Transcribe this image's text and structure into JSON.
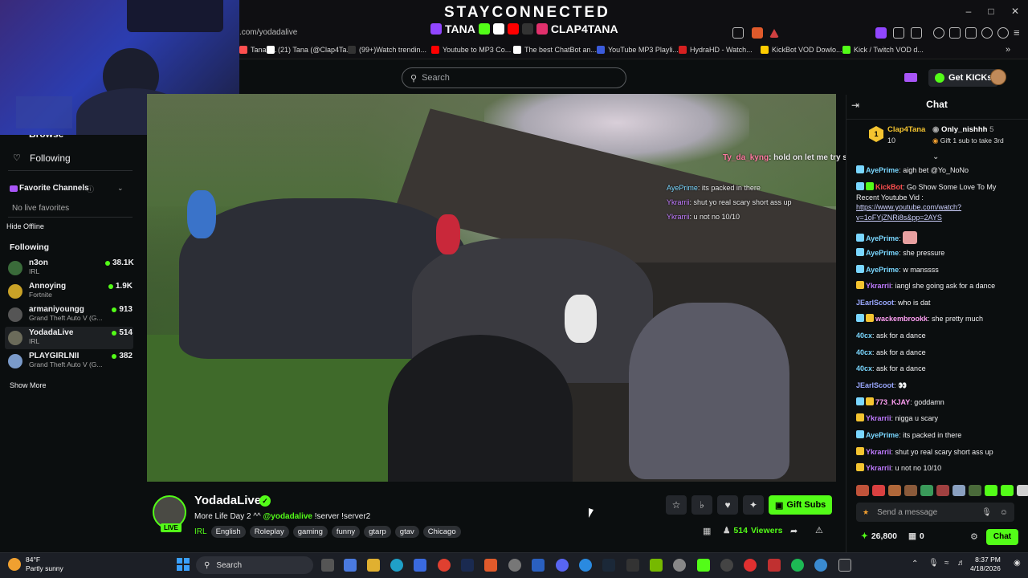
{
  "browser": {
    "url": ".com/yodadalive",
    "bookmarks": [
      {
        "label": "Tana -...",
        "color": "#ff4f4f"
      },
      {
        "label": "(21) Tana (@Clap4Ta...",
        "color": "#ffffff"
      },
      {
        "label": "(99+)Watch trendin...",
        "color": "#222222"
      },
      {
        "label": "Youtube to MP3 Co...",
        "color": "#ff0000"
      },
      {
        "label": "The best ChatBot an...",
        "color": "#ffffff"
      },
      {
        "label": "YouTube MP3 Playli...",
        "color": "#3b5bdb"
      },
      {
        "label": "HydraHD - Watch...",
        "color": "#d62020"
      },
      {
        "label": "KickBot VOD Dowlo...",
        "color": "#ffcc00"
      },
      {
        "label": "Kick / Twitch VOD d...",
        "color": "#53fc18"
      }
    ]
  },
  "overlay": {
    "headline": "STAYCONNECTED",
    "handle_left": "TANA",
    "handle_right": "CLAP4TANA"
  },
  "header": {
    "search_placeholder": "Search",
    "get_kicks": "Get KICKs"
  },
  "sidebar": {
    "browse_label": "Browse",
    "following_nav": "Following",
    "favorite_channels": "Favorite Channels",
    "no_favorites": "No live favorites",
    "hide_offline": "Hide Offline",
    "following_heading": "Following",
    "show_more": "Show More",
    "channels": [
      {
        "name": "n3on",
        "game": "IRL",
        "viewers": "38.1K",
        "avatar_color": "#3a6b3a"
      },
      {
        "name": "Annoying",
        "game": "Fortnite",
        "viewers": "1.9K",
        "avatar_color": "#c9a227"
      },
      {
        "name": "armaniyoungg",
        "game": "Grand Theft Auto V (G...",
        "viewers": "913",
        "avatar_color": "#555555"
      },
      {
        "name": "YodadaLive",
        "game": "IRL",
        "viewers": "514",
        "avatar_color": "#6b6b5a"
      },
      {
        "name": "PLAYGIRLNII",
        "game": "Grand Theft Auto V (G...",
        "viewers": "382",
        "avatar_color": "#7a9ac9"
      }
    ]
  },
  "video_overlay_chat": [
    {
      "user": "Ty_da_kyng",
      "text": ": hold on let me try sum"
    },
    {
      "user": "AyePrime",
      "text": ": its packed in there"
    },
    {
      "user": "Ykrarrii",
      "text": ": shut yo real scary short ass up"
    },
    {
      "user": "Ykrarrii",
      "text": ": u not no 10/10"
    }
  ],
  "stream": {
    "channel_name": "YodadaLive",
    "live_badge": "LIVE",
    "title_prefix": "More Life Day 2 ^^ ",
    "title_mention": "@yodadalive",
    "title_suffix": " !server !server2",
    "category": "IRL",
    "tags": [
      "English",
      "Roleplay",
      "gaming",
      "funny",
      "gtarp",
      "gtav",
      "Chicago"
    ],
    "gift_subs": "Gift Subs",
    "viewers": "514",
    "viewers_label": "Viewers"
  },
  "chat": {
    "title": "Chat",
    "pinned_gifter": "Clap4Tana",
    "pinned_gifter_count": "10",
    "pinned_top": "Only_nishhh",
    "pinned_top_count": "5",
    "pinned_cta": "Gift 1 sub to take 3rd",
    "messages": [
      {
        "user": "AyePrime",
        "color": "#7ad7ff",
        "text": ": aigh bet @Yo_NoNo"
      },
      {
        "user": "KickBot",
        "color": "#ff4f4f",
        "text": ": Go Show Some Love To My Recent Youtube Vid :"
      },
      {
        "user": "",
        "color": "#ffffff",
        "text": "https://www.youtube.com/watch?v=1oFYjZNRi8s&pp=2AYS"
      },
      {
        "user": "AyePrime",
        "color": "#7ad7ff",
        "text": ":"
      },
      {
        "user": "AyePrime",
        "color": "#7ad7ff",
        "text": ": she pressure"
      },
      {
        "user": "AyePrime",
        "color": "#7ad7ff",
        "text": ": w manssss"
      },
      {
        "user": "Ykrarrii",
        "color": "#c07aff",
        "text": ": iangl she going ask for a dance"
      },
      {
        "user": "JEarlScoot",
        "color": "#9aa8ff",
        "text": ": who is dat"
      },
      {
        "user": "wackembrookk",
        "color": "#ff9ff3",
        "text": ": she pretty much"
      },
      {
        "user": "40cx",
        "color": "#7ad7ff",
        "text": ": ask for a dance"
      },
      {
        "user": "40cx",
        "color": "#7ad7ff",
        "text": ": ask for a dance"
      },
      {
        "user": "40cx",
        "color": "#7ad7ff",
        "text": ": ask for a dance"
      },
      {
        "user": "JEarlScoot",
        "color": "#9aa8ff",
        "text": ": 👀"
      },
      {
        "user": "773_KJAY",
        "color": "#ff9ff3",
        "text": ": goddamn"
      },
      {
        "user": "Ykrarrii",
        "color": "#c07aff",
        "text": ": nigga u scary"
      },
      {
        "user": "AyePrime",
        "color": "#7ad7ff",
        "text": ": its packed in there"
      },
      {
        "user": "Ykrarrii",
        "color": "#c07aff",
        "text": ": shut yo real scary short ass up"
      },
      {
        "user": "Ykrarrii",
        "color": "#c07aff",
        "text": ": u not no 10/10"
      }
    ],
    "input_placeholder": "Send a message",
    "points": "26,800",
    "drops": "0",
    "chat_button": "Chat"
  },
  "taskbar": {
    "temp": "84°F",
    "weather": "Partly sunny",
    "search": "Search",
    "time": "8:37 PM",
    "date": "4/18/2026"
  },
  "colors": {
    "accent": "#53fc18",
    "background": "#0b0e0f"
  }
}
